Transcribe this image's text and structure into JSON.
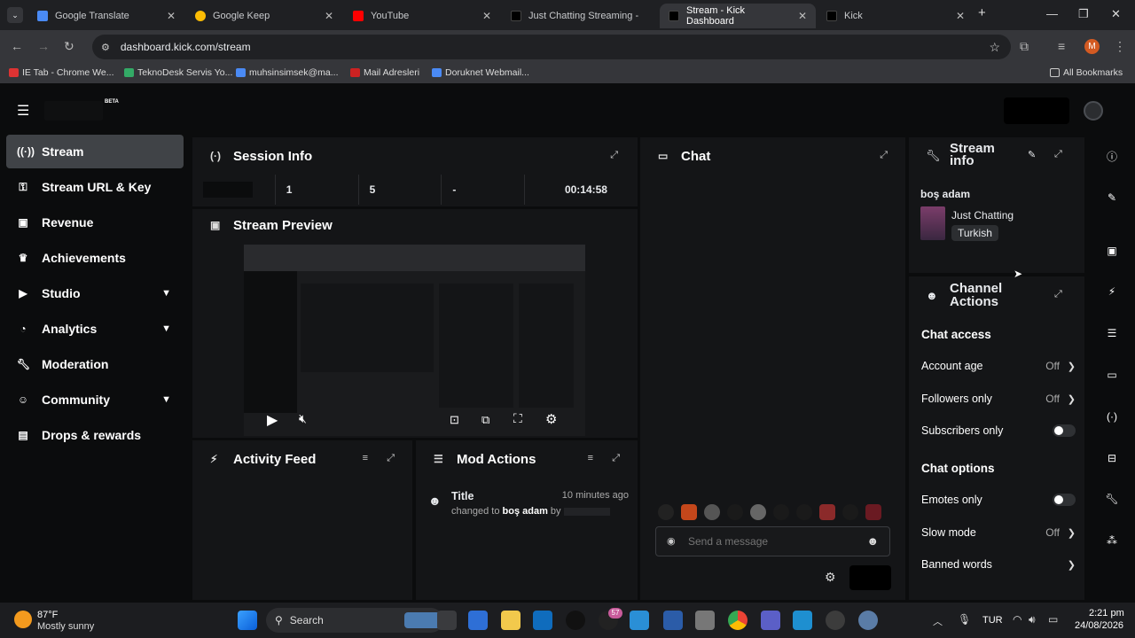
{
  "browser": {
    "tabs": [
      {
        "title": "Google Translate",
        "active": false
      },
      {
        "title": "Google Keep",
        "active": false
      },
      {
        "title": "YouTube",
        "active": false
      },
      {
        "title": "Just Chatting Streaming - K",
        "active": false
      },
      {
        "title": "Stream - Kick Dashboard",
        "active": true
      },
      {
        "title": "Kick",
        "active": false
      }
    ],
    "url": "dashboard.kick.com/stream",
    "profile_initial": "M",
    "bookmarks": [
      "IE Tab - Chrome We...",
      "TeknoDesk Servis Yo...",
      "muhsinsimsek@ma...",
      "Mail Adresleri",
      "Doruknet Webmail..."
    ],
    "all_bookmarks": "All Bookmarks"
  },
  "app": {
    "logo_badge": "BETA"
  },
  "sidebar": {
    "items": [
      {
        "label": "Stream",
        "icon": "broadcast-icon",
        "active": true
      },
      {
        "label": "Stream URL & Key",
        "icon": "key-icon"
      },
      {
        "label": "Revenue",
        "icon": "revenue-icon"
      },
      {
        "label": "Achievements",
        "icon": "trophy-icon"
      },
      {
        "label": "Studio",
        "icon": "studio-icon",
        "expandable": true
      },
      {
        "label": "Analytics",
        "icon": "analytics-icon",
        "expandable": true
      },
      {
        "label": "Moderation",
        "icon": "wrench-icon"
      },
      {
        "label": "Community",
        "icon": "people-icon",
        "expandable": true
      },
      {
        "label": "Drops & rewards",
        "icon": "gift-icon"
      }
    ]
  },
  "session": {
    "title": "Session Info",
    "stats": [
      "1",
      "5",
      "-",
      "00:14:58"
    ]
  },
  "preview": {
    "title": "Stream Preview"
  },
  "activity": {
    "title": "Activity Feed"
  },
  "mod": {
    "title": "Mod Actions",
    "entry": {
      "title": "Title",
      "time": "10 minutes ago",
      "prefix": "changed to",
      "value": "boş adam",
      "by": "by"
    }
  },
  "chat": {
    "title": "Chat",
    "placeholder": "Send a message"
  },
  "stream_info": {
    "title": "Stream info",
    "stream_title": "boş adam",
    "category": "Just Chatting",
    "language": "Turkish"
  },
  "channel_actions": {
    "title": "Channel Actions",
    "chat_access": "Chat access",
    "account_age": {
      "label": "Account age",
      "value": "Off"
    },
    "followers_only": {
      "label": "Followers only",
      "value": "Off"
    },
    "subscribers_only": {
      "label": "Subscribers only"
    },
    "chat_options": "Chat options",
    "emotes_only": {
      "label": "Emotes only"
    },
    "slow_mode": {
      "label": "Slow mode",
      "value": "Off"
    },
    "banned_words": {
      "label": "Banned words"
    }
  },
  "taskbar": {
    "weather_temp": "87°F",
    "weather_desc": "Mostly sunny",
    "search": "Search",
    "badge": "57",
    "lang": "TUR",
    "time": "2:21 pm",
    "date": "24/08/2026"
  },
  "colors": {
    "accent_green": "#53fc18",
    "panel_bg": "#141517",
    "page_bg": "#0b0c0d"
  }
}
